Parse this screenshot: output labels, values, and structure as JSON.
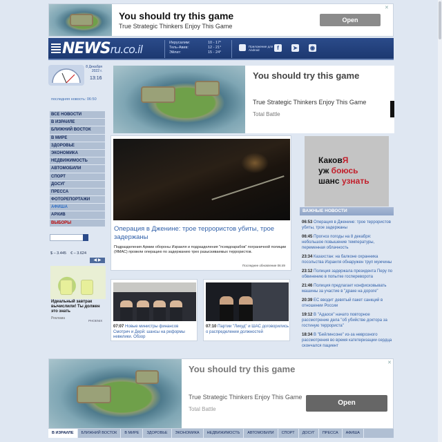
{
  "ads": {
    "top": {
      "headline": "You should try this game",
      "sub": "True Strategic Thinkers Enjoy This Game",
      "button": "Open"
    },
    "main": {
      "headline": "You should try this game",
      "sub": "True Strategic Thinkers Enjoy This Game",
      "brand": "Total Battle"
    },
    "bottom": {
      "headline": "You should try this game",
      "sub": "True Strategic Thinkers Enjoy This Game",
      "brand": "Total Battle",
      "button": "Open"
    },
    "right": {
      "line1a": "Каков",
      "line1b": "Я",
      "line2a": "уж ",
      "line2b": "боюсь",
      "line3a": "шанс ",
      "line3b": "узнать"
    },
    "left": {
      "caption": "Идеальный завтрак вычислили! Ты должен это знать",
      "label": "Реклама",
      "brand": "PHOENIX"
    }
  },
  "header": {
    "logo_main": "NEWS",
    "logo_domain": "ru.co.il",
    "weather": [
      {
        "city": "Иерусалим:",
        "temp": "10 - 17°"
      },
      {
        "city": "Тель-Авив:",
        "temp": "12 - 21°"
      },
      {
        "city": "Эйлат:",
        "temp": "15 - 24°"
      }
    ],
    "app_text": "Приложение для Android"
  },
  "sidebar": {
    "date": "8 Декабря 2022 г.",
    "time": "13:16",
    "last_news": "последняя новость: 06:50",
    "menu": [
      "ВСЕ НОВОСТИ",
      "В ИЗРАИЛЕ",
      "БЛИЖНИЙ ВОСТОК",
      "В МИРЕ",
      "ЗДОРОВЬЕ",
      "ЭКОНОМИКА",
      "НЕДВИЖИМОСТЬ",
      "АВТОМОБИЛИ",
      "СПОРТ",
      "ДОСУГ",
      "ПРЕССА",
      "ФОТОРЕПОРТАЖИ",
      "АФИША",
      "АРХИВ",
      "ВЫБОРЫ"
    ],
    "rates": {
      "usd": "$ – 3.445",
      "eur": "€ – 3.624"
    }
  },
  "top_story": {
    "title": "Операция в Дженине: трое террористов убиты, трое задержаны",
    "desc": "Подразделения Армии обороны Израиля и подразделения \"псевдоарабов\" пограничной полиции (ЯМАС) провели операцию по задержанию трех разыскиваемых террористов.",
    "updated": "Последнее обновление 06:49"
  },
  "small_stories": [
    {
      "time": "07:07",
      "title": "Новые министры финансов Смотрич и Дерй: шансы на реформы невелики. Обзор"
    },
    {
      "time": "07:10",
      "title": "Партии \"Ликуд\" и ШАС договорились о распределении должностей"
    }
  ],
  "important": {
    "heading": "ВАЖНЫЕ НОВОСТИ",
    "items": [
      {
        "time": "06:53",
        "text": "Операция в Дженине: трое террористов убиты, трое задержаны"
      },
      {
        "time": "06:45",
        "text": "Прогноз погоды на 8 декабря: небольшое повышение температуры, переменная облачность"
      },
      {
        "time": "23:34",
        "text": "Казахстан: на балконе охранника посольства Израиля обнаружен труп мужчины"
      },
      {
        "time": "23:12",
        "text": "Полиция задержала президента Перу по обвинению в попытке госпереворота"
      },
      {
        "time": "21:46",
        "text": "Полиция предлагает конфисковывать машины за участие в \"драке на дороге\""
      },
      {
        "time": "20:39",
        "text": "ЕС вводит девятый пакет санкций в отношении России"
      },
      {
        "time": "19:12",
        "text": "В \"Адаосе\" начато повторное рассмотрение дела \"об убийстве доктора за гостиную террориста\""
      },
      {
        "time": "18:34",
        "text": "В \"Бейлинсоне\" из-за неврозного рассмотрения во время катетеризации сердца скончался пациент"
      }
    ]
  },
  "bottom_nav": [
    "В ИЗРАИЛЕ",
    "БЛИЖНИЙ ВОСТОК",
    "В МИРЕ",
    "ЗДОРОВЬЕ",
    "ЭКОНОМИКА",
    "НЕДВИЖИМОСТЬ",
    "АВТОМОБИЛИ",
    "СПОРТ",
    "ДОСУГ",
    "ПРЕССА",
    "АФИША"
  ]
}
